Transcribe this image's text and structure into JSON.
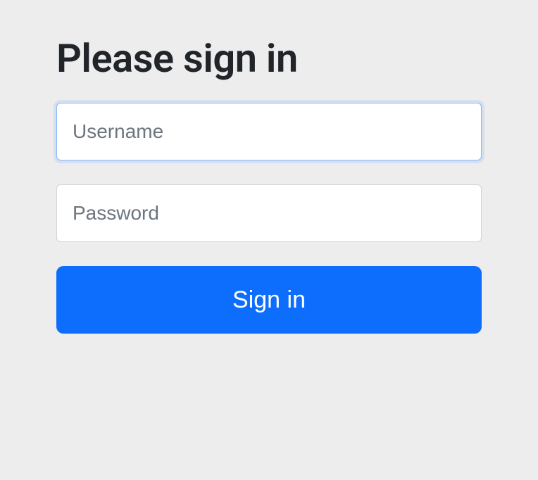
{
  "form": {
    "heading": "Please sign in",
    "username_placeholder": "Username",
    "username_value": "",
    "password_placeholder": "Password",
    "password_value": "",
    "submit_label": "Sign in"
  }
}
